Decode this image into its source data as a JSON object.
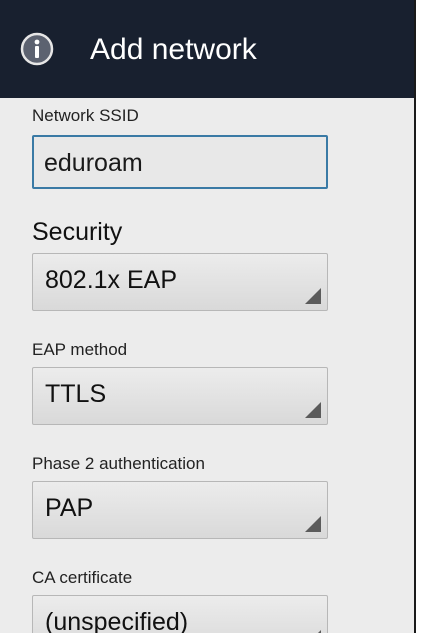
{
  "header": {
    "title": "Add network",
    "icon": "info-icon"
  },
  "ssid": {
    "label": "Network SSID",
    "value": "eduroam"
  },
  "security": {
    "label": "Security",
    "value": "802.1x EAP"
  },
  "eap_method": {
    "label": "EAP method",
    "value": "TTLS"
  },
  "phase2": {
    "label": "Phase 2 authentication",
    "value": "PAP"
  },
  "ca_cert": {
    "label": "CA certificate",
    "value": "(unspecified)"
  },
  "colors": {
    "header_bg": "#18202f",
    "accent": "#3a7aa5"
  }
}
